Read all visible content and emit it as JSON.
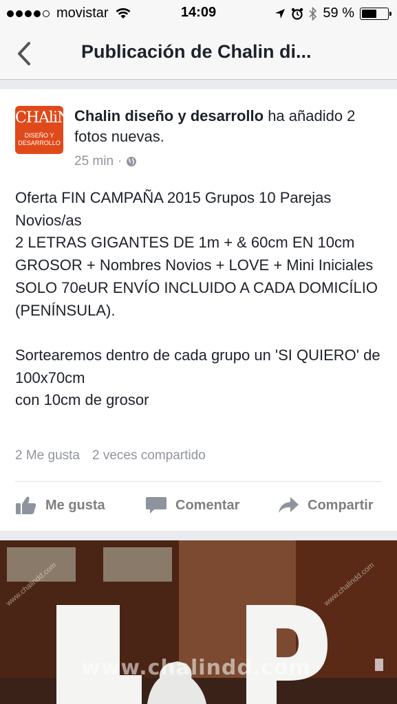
{
  "status_bar": {
    "carrier": "movistar",
    "time": "14:09",
    "battery_percent": "59 %",
    "battery_level": 0.59,
    "icons": [
      "signal-dots",
      "wifi-icon",
      "location-arrow-icon",
      "alarm-icon",
      "bluetooth-icon",
      "battery-icon"
    ]
  },
  "nav": {
    "title": "Publicación de Chalin di...",
    "back_icon": "chevron-left-icon"
  },
  "post": {
    "logo_text_top": "CHAliN",
    "logo_text_bottom": "DISEÑO Y\nDESARROLLO",
    "page_name": "Chalin diseño y desarrollo",
    "action_text": " ha añadido 2 fotos nuevas.",
    "time": "25 min",
    "separator": "·",
    "privacy_icon": "globe-icon",
    "body_paragraph_1": "Oferta FIN CAMPAÑA 2015 Grupos 10 Parejas Novios/as\n2 LETRAS GIGANTES DE 1m + & 60cm EN 10cm GROSOR + Nombres Novios + LOVE + Mini Iniciales\nSOLO 70eUR ENVÍO INCLUIDO A CADA DOMICÍLIO (PENÍNSULA).",
    "body_paragraph_2": "Sortearemos dentro de cada grupo un 'SI QUIERO' de 100x70cm\ncon 10cm de grosor",
    "likes": "2 Me gusta",
    "shares": "2 veces compartido"
  },
  "actions": {
    "like": "Me gusta",
    "comment": "Comentar",
    "share": "Compartir"
  },
  "photo": {
    "watermark": "www.chalindd.com",
    "watermark_small_left": "www.chalindd.com",
    "watermark_small_right": "www.chalindd.com",
    "letters": "L & P"
  },
  "colors": {
    "logo_bg": "#e04a1a",
    "text": "#1d2129",
    "muted": "#90949c",
    "action": "#7f7f7f"
  }
}
